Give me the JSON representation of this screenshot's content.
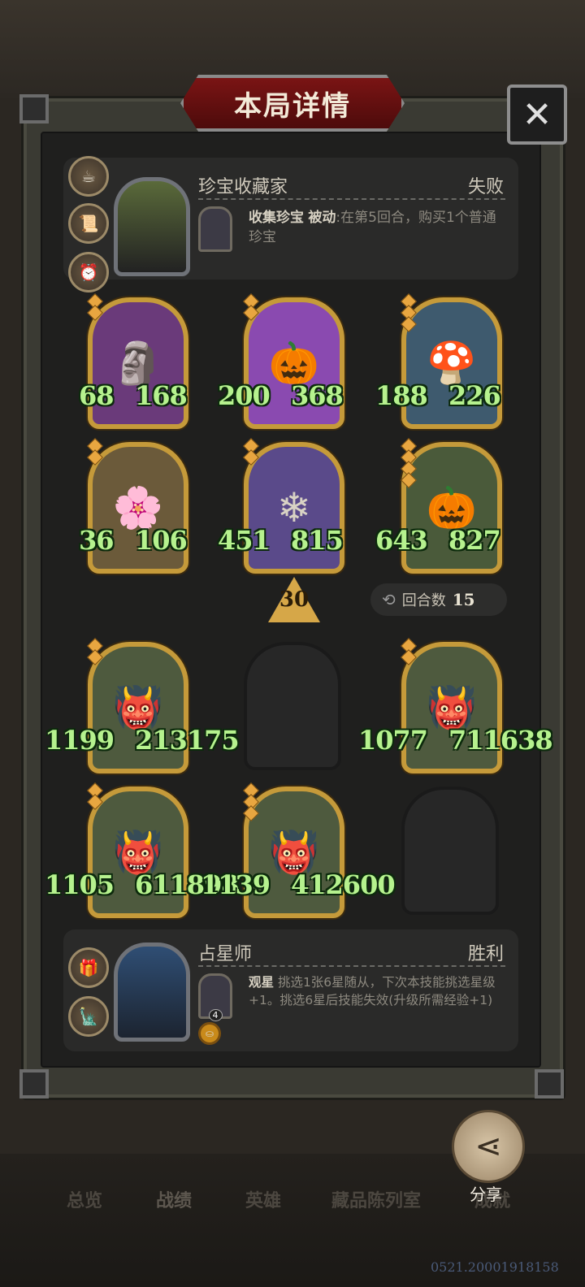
{
  "window": {
    "title": "本局详情",
    "close_symbol": "✕"
  },
  "opponent": {
    "name": "珍宝收藏家",
    "result": "失败",
    "relics": [
      "teacup-icon",
      "scroll-icon",
      "clock-icon"
    ],
    "skill": {
      "name": "收集珍宝",
      "type": "被动",
      "desc": ":在第5回合，购买1个普通珍宝"
    }
  },
  "enemy_board": [
    {
      "attack": "68",
      "health": "168",
      "pips": 2,
      "art": "🗿"
    },
    {
      "attack": "200",
      "health": "368",
      "pips": 2,
      "art": "🎃"
    },
    {
      "attack": "188",
      "health": "226",
      "pips": 3,
      "art": "🍄"
    },
    {
      "attack": "36",
      "health": "106",
      "pips": 2,
      "art": "🌸"
    },
    {
      "attack": "451",
      "health": "815",
      "pips": 2,
      "art": "❄"
    },
    {
      "attack": "643",
      "health": "827",
      "pips": 4,
      "art": "🎃"
    }
  ],
  "level": "30",
  "round": {
    "label": "回合数",
    "value": "15"
  },
  "player_board": [
    {
      "attack": "1199",
      "health": "213175",
      "pips": 2,
      "art": "👹"
    },
    {
      "attack": "1077",
      "health": "711638",
      "pips": 2,
      "art": "👹"
    },
    {
      "attack": "1105",
      "health": "611898",
      "pips": 2,
      "art": "👹"
    },
    {
      "attack": "1139",
      "health": "412600",
      "pips": 3,
      "art": "👹"
    }
  ],
  "player": {
    "name": "占星师",
    "result": "胜利",
    "relics": [
      "gift-icon",
      "totem-icon"
    ],
    "skill_level": "4",
    "skill": {
      "name": "观星",
      "desc": " 挑选1张6星随从，下次本技能挑选星级+1。挑选6星后技能失效(升级所需经验+1)"
    }
  },
  "tabs": [
    "总览",
    "战绩",
    "英雄",
    "藏品陈列室",
    "成就"
  ],
  "share_label": "分享",
  "uid": "0521.20001918158"
}
